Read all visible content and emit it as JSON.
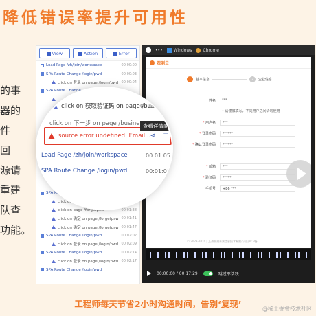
{
  "header": {
    "title": "降低错误率提升可用性"
  },
  "left_text": {
    "lines": [
      "的事",
      "器的",
      "件",
      "回",
      "源请",
      "重建",
      "队查",
      "功能。"
    ]
  },
  "event_panel": {
    "filters": [
      "View",
      "Action",
      "Error"
    ],
    "rows": [
      {
        "kind": "page",
        "text": "Load Page /zh/join/workspace",
        "ts": "00:00:00"
      },
      {
        "kind": "spa",
        "text": "SPA Route Change /login/pwd",
        "ts": "00:00:03"
      },
      {
        "kind": "sub",
        "text": "click on 登录 on page /login/pwd",
        "ts": "00:00:04"
      },
      {
        "kind": "spa",
        "text": "SPA Route Change",
        "ts": ""
      },
      {
        "kind": "sub",
        "text": "",
        "ts": ""
      },
      {
        "kind": "sub",
        "text": "",
        "ts": ""
      },
      {
        "kind": "sub",
        "text": "",
        "ts": ""
      },
      {
        "kind": "sub",
        "text": "",
        "ts": ""
      },
      {
        "kind": "sub",
        "text": "",
        "ts": ""
      },
      {
        "kind": "sub",
        "text": "",
        "ts": ""
      },
      {
        "kind": "sub",
        "text": "",
        "ts": ""
      },
      {
        "kind": "sub",
        "text": "",
        "ts": ""
      },
      {
        "kind": "sub",
        "text": "",
        "ts": ""
      },
      {
        "kind": "sub",
        "text": "",
        "ts": ""
      },
      {
        "kind": "sub",
        "text": "",
        "ts": ""
      },
      {
        "kind": "spa",
        "text": "SPA Route Change /forgetpsw",
        "ts": "00:01:21"
      },
      {
        "kind": "sub",
        "text": "click on 获取验证码 on page /forgetpsw",
        "ts": "00:01:35"
      },
      {
        "kind": "sub",
        "text": "click on page /forgetpsw",
        "ts": "00:01:38"
      },
      {
        "kind": "sub",
        "text": "click on 确定 on page /forgetpsw",
        "ts": "00:01:41"
      },
      {
        "kind": "sub",
        "text": "click on 确定 on page /forgetpsw",
        "ts": "00:01:47"
      },
      {
        "kind": "spa",
        "text": "SPA Route Change /login/pwd",
        "ts": "00:02:02"
      },
      {
        "kind": "sub",
        "text": "click on 登录 on page /login/pwd",
        "ts": "00:02:09"
      },
      {
        "kind": "spa",
        "text": "SPA Route Change /login/pwd",
        "ts": "00:02:14"
      },
      {
        "kind": "sub",
        "text": "click on 登录 on page /login/pwd",
        "ts": "00:02:17"
      },
      {
        "kind": "spa",
        "text": "SPA Route Change /login/pwd",
        "ts": ""
      }
    ]
  },
  "magnifier": {
    "row1": {
      "text": "click on 获取验证码 on page /busin...",
      "ts": "00:00:38"
    },
    "row2": {
      "text": "click on 下一步 on page /busine...",
      "ts": ""
    },
    "error": {
      "text": "source error undefined: Email...",
      "share_icon": "share-icon",
      "detail_icon": "detail-icon"
    },
    "tooltip": "查看详情面板",
    "row3": {
      "text": "Load Page /zh/join/workspace",
      "ts": "00:01:05"
    },
    "row4": {
      "text": "SPA Route Change /login/pwd",
      "ts": "00:01:09"
    }
  },
  "player": {
    "chrome": {
      "windows_label": "Windows",
      "chrome_label": "Chrome"
    },
    "site": {
      "brand": "观测云",
      "steps": [
        "基本信息",
        "企业信息"
      ],
      "form": [
        {
          "label": "姓名",
          "required": false,
          "value": "***",
          "border": false
        },
        {
          "label": "",
          "required": false,
          "value": "• 请谨慎填写，不同用户之间请勿使用",
          "border": false
        },
        {
          "label": "用户名",
          "required": true,
          "value": "***",
          "border": true
        },
        {
          "label": "登录密码",
          "required": true,
          "value": "******",
          "border": true
        },
        {
          "label": "确认登录密码",
          "required": true,
          "value": "******",
          "border": true
        },
        {
          "label": "",
          "required": false,
          "value": "",
          "border": false
        },
        {
          "label": "邮箱",
          "required": true,
          "value": "***",
          "border": true
        },
        {
          "label": "验证码",
          "required": true,
          "value": "*****",
          "border": true
        },
        {
          "label": "手机号",
          "required": false,
          "value": "+86   ***",
          "border": true
        }
      ],
      "footer": "© 2023-2024 | 上海观测未来信息技术有限公司 沪ICP备"
    },
    "time": "00:00:00 / 00:17:29",
    "skip_label": "跳过不活跃"
  },
  "bottom": {
    "text": "工程师每天节省2小时沟通时间，告别‘复现’"
  },
  "watermark": "@稀土掘金技术社区",
  "colors": {
    "accent": "#f07b2c",
    "error": "#e03a2a",
    "link": "#2c4fa8"
  }
}
